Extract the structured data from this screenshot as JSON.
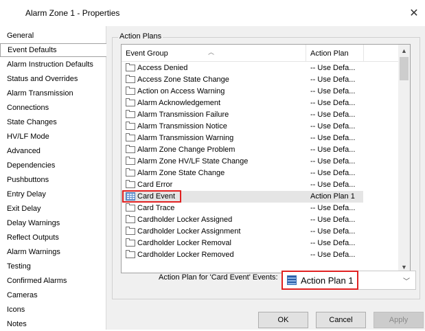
{
  "window": {
    "title": "Alarm Zone 1 - Properties",
    "close_glyph": "✕"
  },
  "nav": {
    "items": [
      {
        "label": "General",
        "selected": false
      },
      {
        "label": "Event Defaults",
        "selected": true
      },
      {
        "label": "Alarm Instruction Defaults",
        "selected": false
      },
      {
        "label": "Status and Overrides",
        "selected": false
      },
      {
        "label": "Alarm Transmission",
        "selected": false
      },
      {
        "label": "Connections",
        "selected": false
      },
      {
        "label": "State Changes",
        "selected": false
      },
      {
        "label": "HV/LF Mode",
        "selected": false
      },
      {
        "label": "Advanced",
        "selected": false
      },
      {
        "label": "Dependencies",
        "selected": false
      },
      {
        "label": "Pushbuttons",
        "selected": false
      },
      {
        "label": "Entry Delay",
        "selected": false
      },
      {
        "label": "Exit Delay",
        "selected": false
      },
      {
        "label": "Delay Warnings",
        "selected": false
      },
      {
        "label": "Reflect Outputs",
        "selected": false
      },
      {
        "label": "Alarm Warnings",
        "selected": false
      },
      {
        "label": "Testing",
        "selected": false
      },
      {
        "label": "Confirmed Alarms",
        "selected": false
      },
      {
        "label": "Cameras",
        "selected": false
      },
      {
        "label": "Icons",
        "selected": false
      },
      {
        "label": "Notes",
        "selected": false
      }
    ]
  },
  "action_plans": {
    "group_label": "Action Plans",
    "columns": {
      "event_group": "Event Group",
      "action_plan": "Action Plan"
    },
    "rows": [
      {
        "name": "Access Denied",
        "plan": "-- Use Defa...",
        "selected": false
      },
      {
        "name": "Access Zone State Change",
        "plan": "-- Use Defa...",
        "selected": false
      },
      {
        "name": "Action on Access Warning",
        "plan": "-- Use Defa...",
        "selected": false
      },
      {
        "name": "Alarm Acknowledgement",
        "plan": "-- Use Defa...",
        "selected": false
      },
      {
        "name": "Alarm Transmission Failure",
        "plan": "-- Use Defa...",
        "selected": false
      },
      {
        "name": "Alarm Transmission Notice",
        "plan": "-- Use Defa...",
        "selected": false
      },
      {
        "name": "Alarm Transmission Warning",
        "plan": "-- Use Defa...",
        "selected": false
      },
      {
        "name": "Alarm Zone Change Problem",
        "plan": "-- Use Defa...",
        "selected": false
      },
      {
        "name": "Alarm Zone HV/LF State Change",
        "plan": "-- Use Defa...",
        "selected": false
      },
      {
        "name": "Alarm Zone State Change",
        "plan": "-- Use Defa...",
        "selected": false
      },
      {
        "name": "Card Error",
        "plan": "-- Use Defa...",
        "selected": false
      },
      {
        "name": "Card Event",
        "plan": "Action Plan 1",
        "selected": true
      },
      {
        "name": "Card Trace",
        "plan": "-- Use Defa...",
        "selected": false
      },
      {
        "name": "Cardholder Locker Assigned",
        "plan": "-- Use Defa...",
        "selected": false
      },
      {
        "name": "Cardholder Locker Assignment",
        "plan": "-- Use Defa...",
        "selected": false
      },
      {
        "name": "Cardholder Locker Removal",
        "plan": "-- Use Defa...",
        "selected": false
      },
      {
        "name": "Cardholder Locker Removed",
        "plan": "-- Use Defa...",
        "selected": false
      }
    ],
    "selector_label": "Action Plan for 'Card Event' Events:",
    "selector_value": "Action Plan 1"
  },
  "buttons": {
    "ok": "OK",
    "cancel": "Cancel",
    "apply": "Apply"
  },
  "colors": {
    "highlight_red": "#e02020",
    "selection_gray": "#e5e5e5"
  }
}
